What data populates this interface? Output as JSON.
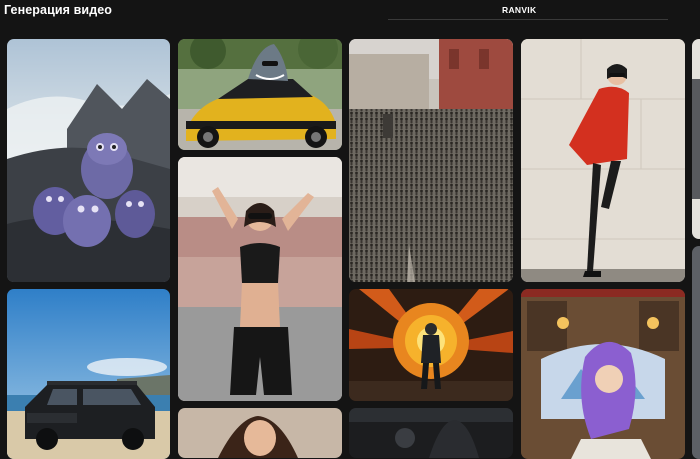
{
  "header": {
    "title": "Генерация видео",
    "brand_tab": "RANVIK"
  },
  "gallery": {
    "items": [
      {
        "subject": "furry-monsters-on-rocks"
      },
      {
        "subject": "shark-driving-yellow-lamborghini"
      },
      {
        "subject": "crowd-on-square"
      },
      {
        "subject": "woman-in-red-dress"
      },
      {
        "subject": "black-suv-on-beach"
      },
      {
        "subject": "woman-in-sportswear"
      },
      {
        "subject": "man-walking-from-explosion"
      },
      {
        "subject": "purple-haired-girl-in-library"
      },
      {
        "subject": "woman-portrait"
      },
      {
        "subject": "hooded-figures-city"
      }
    ]
  },
  "colors": {
    "background": "#141414",
    "text": "#ffffff"
  }
}
